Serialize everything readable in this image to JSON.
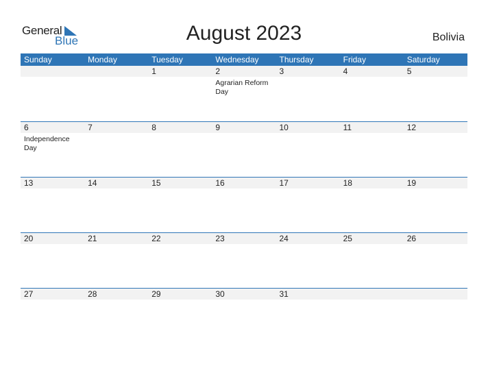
{
  "logo": {
    "general": "General",
    "blue": "Blue"
  },
  "title": "August 2023",
  "country": "Bolivia",
  "colors": {
    "accent": "#2e75b6",
    "row_bg": "#f2f2f2"
  },
  "weekdays": [
    "Sunday",
    "Monday",
    "Tuesday",
    "Wednesday",
    "Thursday",
    "Friday",
    "Saturday"
  ],
  "weeks": [
    {
      "days": [
        "",
        "",
        "1",
        "2",
        "3",
        "4",
        "5"
      ],
      "events": [
        "",
        "",
        "",
        "Agrarian Reform Day",
        "",
        "",
        ""
      ]
    },
    {
      "days": [
        "6",
        "7",
        "8",
        "9",
        "10",
        "11",
        "12"
      ],
      "events": [
        "Independence Day",
        "",
        "",
        "",
        "",
        "",
        ""
      ]
    },
    {
      "days": [
        "13",
        "14",
        "15",
        "16",
        "17",
        "18",
        "19"
      ],
      "events": [
        "",
        "",
        "",
        "",
        "",
        "",
        ""
      ]
    },
    {
      "days": [
        "20",
        "21",
        "22",
        "23",
        "24",
        "25",
        "26"
      ],
      "events": [
        "",
        "",
        "",
        "",
        "",
        "",
        ""
      ]
    },
    {
      "days": [
        "27",
        "28",
        "29",
        "30",
        "31",
        "",
        ""
      ],
      "events": [
        "",
        "",
        "",
        "",
        "",
        "",
        ""
      ]
    }
  ]
}
